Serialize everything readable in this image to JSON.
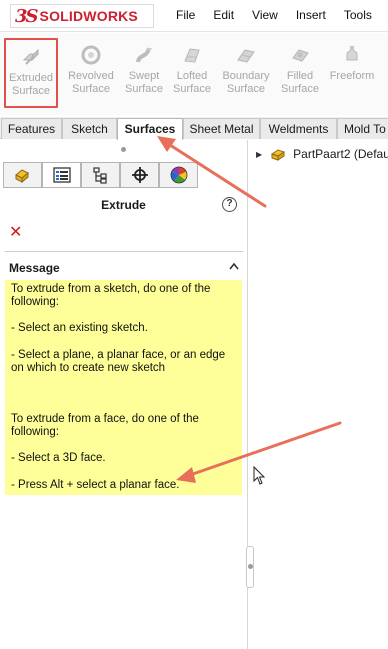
{
  "app": {
    "brand_ds": "3S",
    "brand_name": "SOLIDWORKS"
  },
  "menu": {
    "items": [
      "File",
      "Edit",
      "View",
      "Insert",
      "Tools",
      "W"
    ]
  },
  "toolbar": {
    "tools": [
      {
        "line1": "Extruded",
        "line2": "Surface",
        "icon": "extruded-surface-icon"
      },
      {
        "line1": "Revolved",
        "line2": "Surface",
        "icon": "revolved-surface-icon"
      },
      {
        "line1": "Swept",
        "line2": "Surface",
        "icon": "swept-surface-icon"
      },
      {
        "line1": "Lofted",
        "line2": "Surface",
        "icon": "lofted-surface-icon"
      },
      {
        "line1": "Boundary",
        "line2": "Surface",
        "icon": "boundary-surface-icon"
      },
      {
        "line1": "Filled",
        "line2": "Surface",
        "icon": "filled-surface-icon"
      },
      {
        "line1": "Freeform",
        "line2": "",
        "icon": "freeform-icon"
      }
    ]
  },
  "tabs": [
    "Features",
    "Sketch",
    "Surfaces",
    "Sheet Metal",
    "Weldments",
    "Mold To"
  ],
  "active_tab": "Surfaces",
  "property_manager": {
    "title": "Extrude",
    "close_symbol": "✕",
    "help_symbol": "?",
    "message_header": "Message",
    "message": {
      "p1": "To extrude from a sketch, do one of the following:",
      "p2": "- Select an existing sketch.",
      "p3": "- Select a plane, a planar face, or an edge on which to create new sketch",
      "p4": "To extrude from a face, do one of the following:",
      "p5": "- Select a 3D face.",
      "p6": "- Press Alt + select a planar face."
    }
  },
  "tree": {
    "part_name": "PartPaart2  (Defau"
  },
  "colors": {
    "brand_red": "#cc1f2f",
    "highlight_box": "#e0504c",
    "annotation_arrow": "#e8705a",
    "message_bg": "#ffff99",
    "close_red": "#d01b1b"
  }
}
